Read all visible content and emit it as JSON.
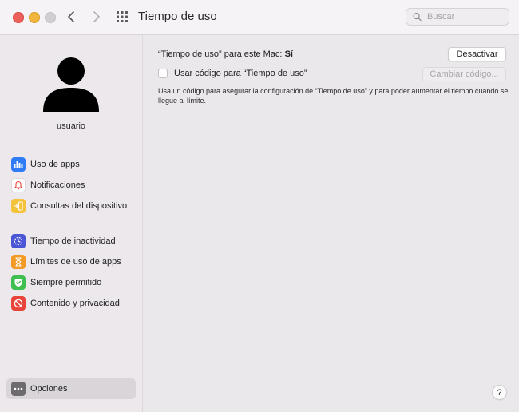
{
  "window": {
    "title": "Tiempo de uso",
    "search_placeholder": "Buscar"
  },
  "sidebar": {
    "username": "usuario",
    "group1": [
      {
        "label": "Uso de apps",
        "icon": "app-usage-icon",
        "color": "#2f7cf6"
      },
      {
        "label": "Notificaciones",
        "icon": "notifications-icon",
        "color": "#ffffff"
      },
      {
        "label": "Consultas del dispositivo",
        "icon": "pickups-icon",
        "color": "#f5c33b"
      }
    ],
    "group2": [
      {
        "label": "Tiempo de inactividad",
        "icon": "downtime-icon",
        "color": "#4b56d6"
      },
      {
        "label": "Límites de uso de apps",
        "icon": "app-limits-icon",
        "color": "#f29a24"
      },
      {
        "label": "Siempre permitido",
        "icon": "always-allowed-icon",
        "color": "#3fbf4f"
      },
      {
        "label": "Contenido y privacidad",
        "icon": "content-privacy-icon",
        "color": "#e8443a"
      }
    ],
    "options_label": "Opciones"
  },
  "main": {
    "status_prefix": "“Tiempo de uso” para este Mac:",
    "status_value": "Sí",
    "deactivate_label": "Desactivar",
    "use_code_label": "Usar código para “Tiempo de uso”",
    "change_code_label": "Cambiar código...",
    "description": "Usa un código para asegurar la configuración de “Tiempo de uso” y para poder aumentar el tiempo cuando se llegue al límite."
  },
  "help_label": "?"
}
